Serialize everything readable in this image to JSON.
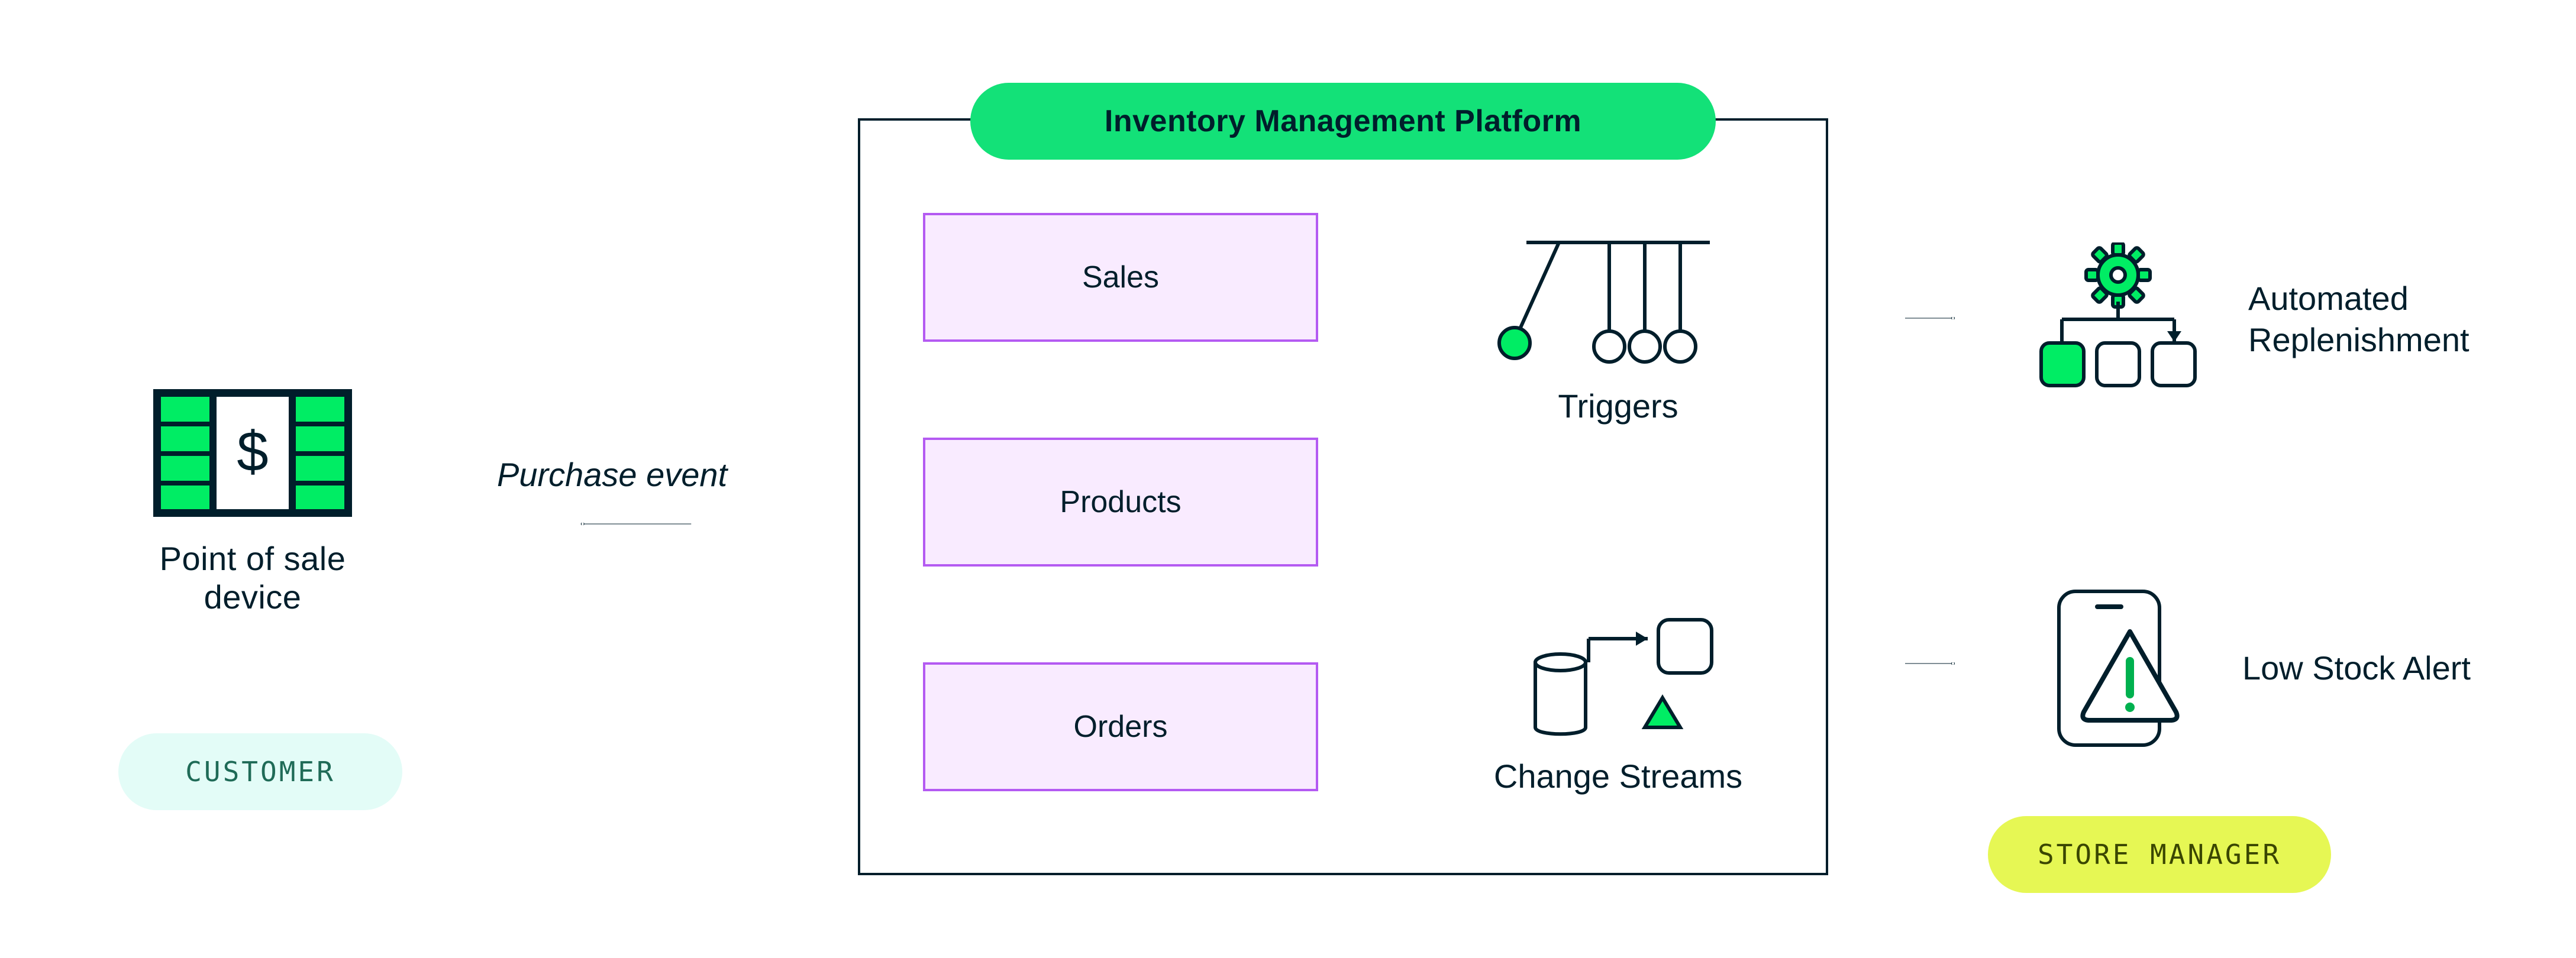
{
  "left": {
    "pos_label": "Point of sale device",
    "edge_label": "Purchase event",
    "role_label": "CUSTOMER"
  },
  "platform": {
    "title": "Inventory Management Platform",
    "collections": {
      "sales": "Sales",
      "products": "Products",
      "orders": "Orders"
    },
    "triggers_label": "Triggers",
    "change_streams_label": "Change Streams"
  },
  "right": {
    "replenish_label": "Automated\nReplenishment",
    "low_stock_label": "Low Stock Alert",
    "role_label": "STORE MANAGER"
  },
  "colors": {
    "ink": "#001e2b",
    "green": "#00ed64",
    "mint": "#e3fcf7",
    "lavender": "#f9ebff",
    "lavender_stroke": "#b45af2",
    "lime": "#e6f754"
  }
}
